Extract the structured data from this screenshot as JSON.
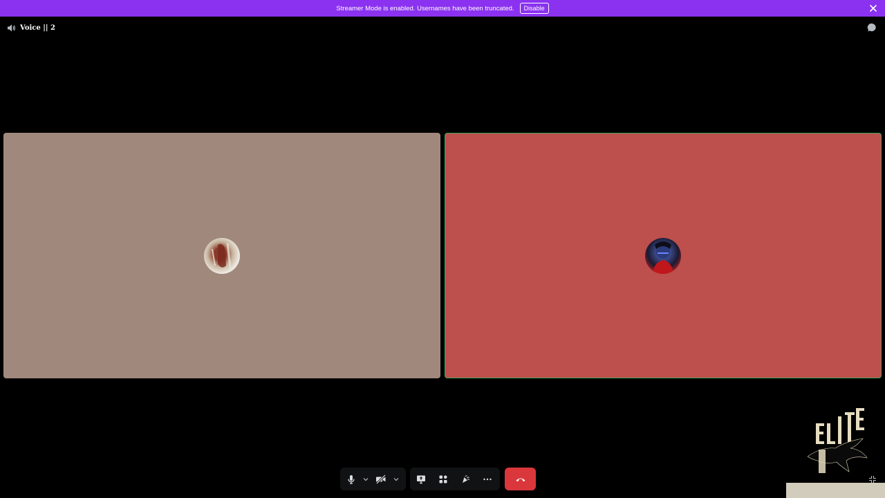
{
  "banner": {
    "message": "Streamer Mode is enabled. Usernames have been truncated.",
    "disable_label": "Disable",
    "close_icon": "close-icon",
    "color": "#8b32f0"
  },
  "header": {
    "title": "Voice || 2",
    "speaker_icon": "speaker-icon",
    "chat_icon": "chat-bubble-icon"
  },
  "tiles": [
    {
      "name": "participant-left",
      "background": "#a0897c",
      "speaking": false
    },
    {
      "name": "participant-right",
      "background": "#bd4f4c",
      "speaking": true,
      "speaking_border": "#3ba55c"
    }
  ],
  "controls": {
    "mic_icon": "microphone-icon",
    "camera_off_icon": "camera-off-icon",
    "share_screen_icon": "share-screen-icon",
    "activities_icon": "activities-icon",
    "soundboard_icon": "soundboard-icon",
    "more_icon": "more-icon",
    "end_call_icon": "hang-up-icon",
    "end_call_color": "#da373c"
  },
  "watermark": {
    "logo_icon": "elite-eagle-logo-icon"
  }
}
